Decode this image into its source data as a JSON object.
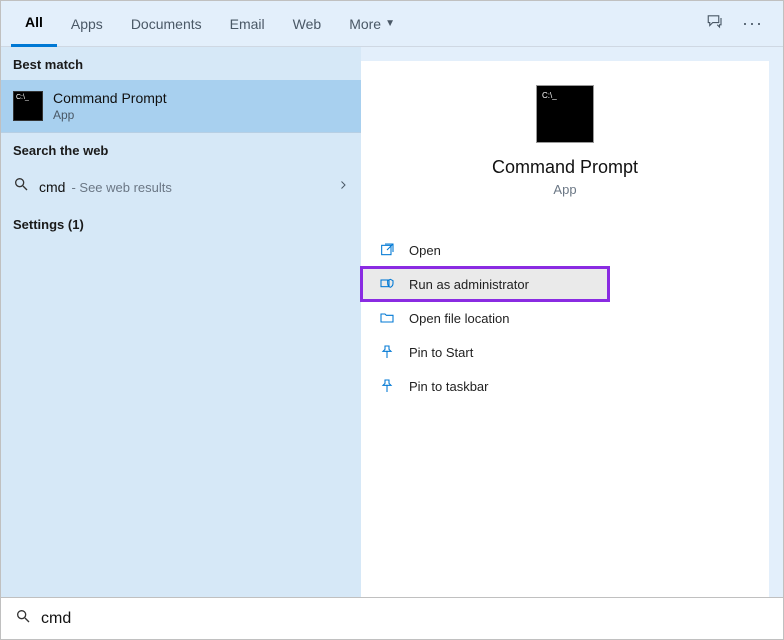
{
  "tabs": {
    "all": "All",
    "apps": "Apps",
    "documents": "Documents",
    "email": "Email",
    "web": "Web",
    "more": "More"
  },
  "sections": {
    "best": "Best match",
    "web": "Search the web",
    "settings": "Settings (1)"
  },
  "bestMatch": {
    "title": "Command Prompt",
    "subtitle": "App"
  },
  "webResult": {
    "query": "cmd",
    "hint": "- See web results"
  },
  "preview": {
    "title": "Command Prompt",
    "subtitle": "App"
  },
  "actions": {
    "open": "Open",
    "runAdmin": "Run as administrator",
    "openLoc": "Open file location",
    "pinStart": "Pin to Start",
    "pinTask": "Pin to taskbar"
  },
  "search": {
    "value": "cmd"
  },
  "colors": {
    "accent": "#0078d4",
    "highlight": "#8a2be2"
  }
}
